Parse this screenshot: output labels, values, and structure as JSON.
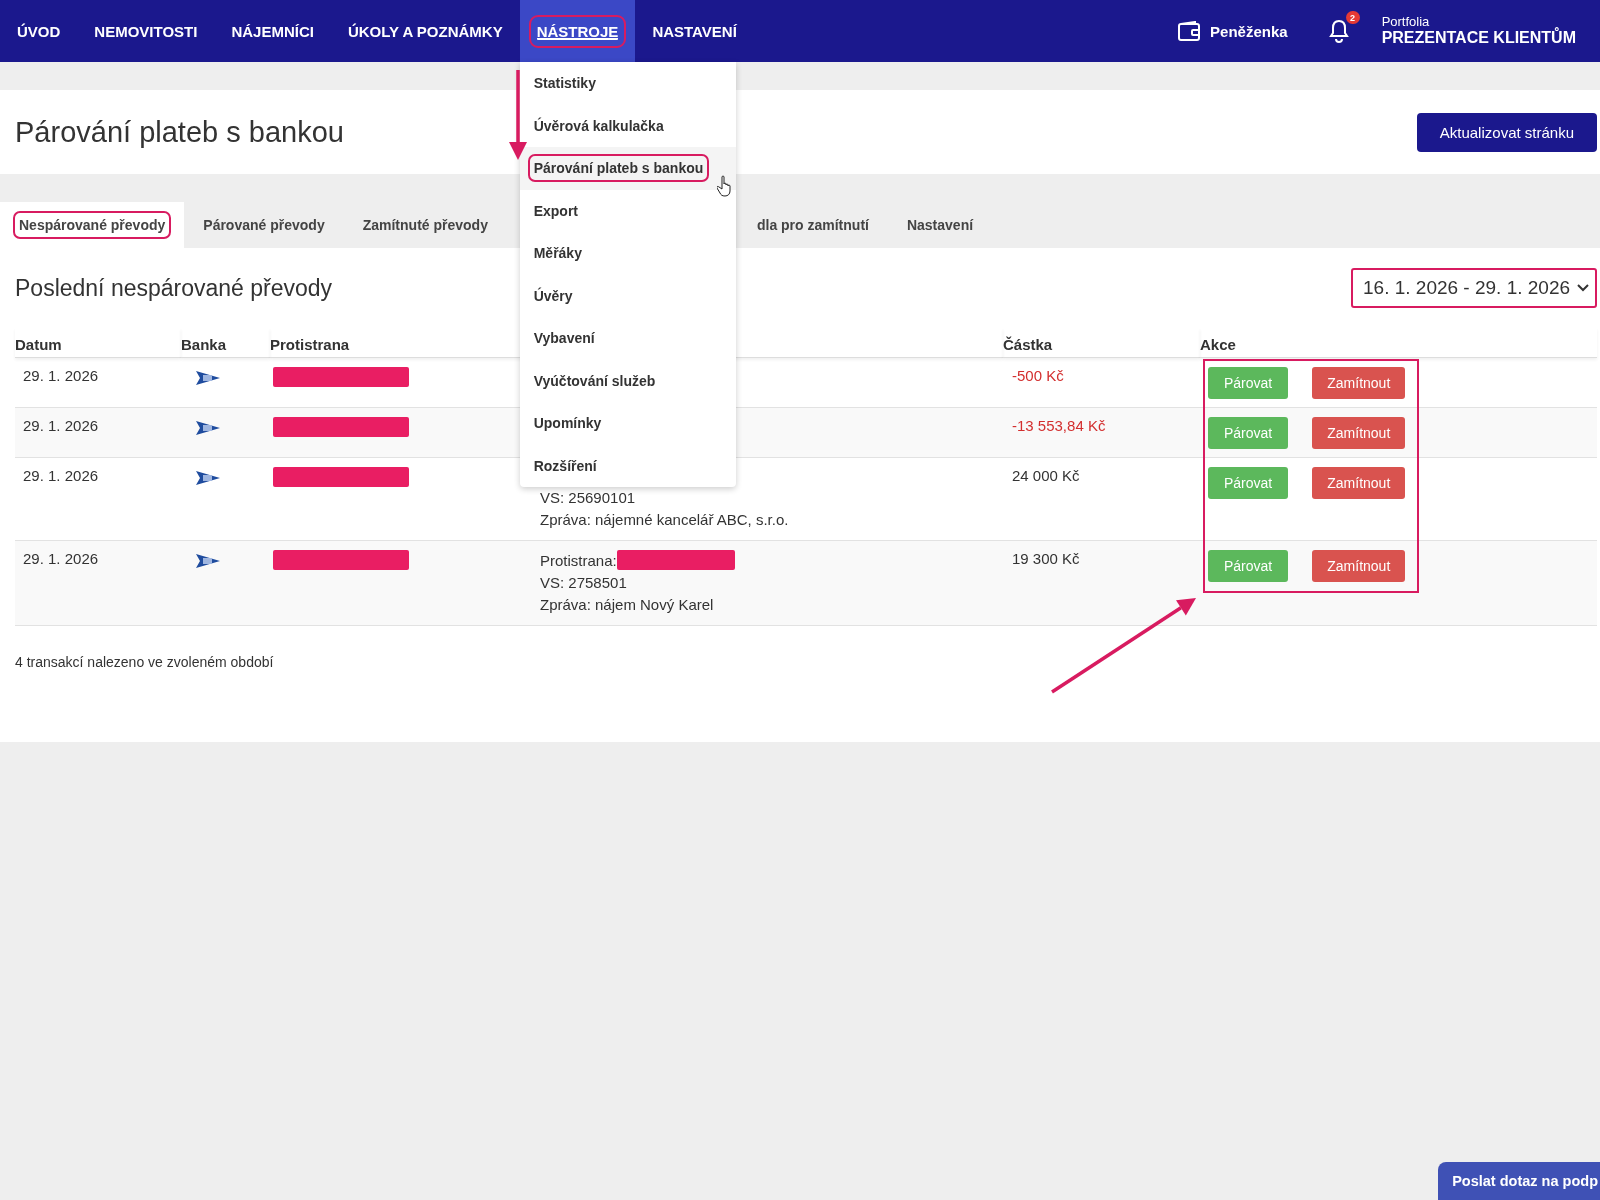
{
  "nav": {
    "items": [
      {
        "label": "ÚVOD",
        "selected": false,
        "highlighted": false
      },
      {
        "label": "NEMOVITOSTI",
        "selected": false,
        "highlighted": false
      },
      {
        "label": "NÁJEMNÍCI",
        "selected": false,
        "highlighted": false
      },
      {
        "label": "ÚKOLY A POZNÁMKY",
        "selected": false,
        "highlighted": false
      },
      {
        "label": "NÁSTROJE",
        "selected": true,
        "highlighted": true
      },
      {
        "label": "NASTAVENÍ",
        "selected": false,
        "highlighted": false
      }
    ],
    "wallet": "Peněženka",
    "notifications": "2",
    "portfolio_label": "Portfolia",
    "portfolio_name": "PREZENTACE KLIENTŮM"
  },
  "dropdown": {
    "items": [
      {
        "label": "Statistiky",
        "hovered": false,
        "highlighted": false
      },
      {
        "label": "Úvěrová kalkulačka",
        "hovered": false,
        "highlighted": false
      },
      {
        "label": "Párování plateb s bankou",
        "hovered": true,
        "highlighted": true
      },
      {
        "label": "Export",
        "hovered": false,
        "highlighted": false
      },
      {
        "label": "Měřáky",
        "hovered": false,
        "highlighted": false
      },
      {
        "label": "Úvěry",
        "hovered": false,
        "highlighted": false
      },
      {
        "label": "Vybavení",
        "hovered": false,
        "highlighted": false
      },
      {
        "label": "Vyúčtování služeb",
        "hovered": false,
        "highlighted": false
      },
      {
        "label": "Upomínky",
        "hovered": false,
        "highlighted": false
      },
      {
        "label": "Rozšíření",
        "hovered": false,
        "highlighted": false
      }
    ]
  },
  "header": {
    "title": "Párování plateb s bankou",
    "button": "Aktualizovat stránku"
  },
  "tabs": [
    {
      "label": "Nespárované převody",
      "selected": true,
      "highlighted": true,
      "kind": "normal"
    },
    {
      "label": "Párované převody",
      "selected": false,
      "highlighted": false,
      "kind": "normal"
    },
    {
      "label": "Zamítnuté převody",
      "selected": false,
      "highlighted": false,
      "kind": "normal"
    },
    {
      "label": "dla pro zamítnutí",
      "selected": false,
      "highlighted": false,
      "kind": "covered"
    },
    {
      "label": "Nastavení",
      "selected": false,
      "highlighted": false,
      "kind": "normal"
    }
  ],
  "section": {
    "title": "Poslední nespárované převody",
    "date_range": "16. 1. 2026 - 29. 1. 2026",
    "date_range_highlighted": true
  },
  "table": {
    "columns": [
      "Datum",
      "Banka",
      "Protistrana",
      "Částka",
      "Akce"
    ],
    "actions_highlighted": true,
    "rows": [
      {
        "date": "29. 1. 2026",
        "counterparty_redacted": true,
        "amount": "-500 Kč",
        "negative": true,
        "actions": [
          {
            "label": "Párovat",
            "kind": "pair"
          },
          {
            "label": "Zamítnout",
            "kind": "reject"
          }
        ]
      },
      {
        "date": "29. 1. 2026",
        "counterparty_redacted": true,
        "amount": "-13 553,84 Kč",
        "negative": true,
        "actions": [
          {
            "label": "Párovat",
            "kind": "pair"
          },
          {
            "label": "Zamítnout",
            "kind": "reject"
          }
        ]
      },
      {
        "date": "29. 1. 2026",
        "counterparty_redacted": true,
        "details": [
          {
            "text": "VS: 25690101",
            "redacted": false
          },
          {
            "text": "Zpráva: nájemné kancelář ABC, s.r.o.",
            "redacted": false
          }
        ],
        "amount": "24 000 Kč",
        "negative": false,
        "actions": [
          {
            "label": "Párovat",
            "kind": "pair"
          },
          {
            "label": "Zamítnout",
            "kind": "reject"
          }
        ]
      },
      {
        "date": "29. 1. 2026",
        "counterparty_redacted": true,
        "details": [
          {
            "text": "Protistrana:",
            "redacted": true
          },
          {
            "text": "VS: 2758501",
            "redacted": false
          },
          {
            "text": "Zpráva: nájem Nový Karel",
            "redacted": false
          }
        ],
        "amount": "19 300 Kč",
        "negative": false,
        "actions": [
          {
            "label": "Párovat",
            "kind": "pair"
          },
          {
            "label": "Zamítnout",
            "kind": "reject"
          }
        ]
      }
    ],
    "footer": "4 transakcí nalezeno ve zvoleném období"
  },
  "annotations": [
    {
      "kind": "arrow"
    },
    {
      "kind": "arrow"
    }
  ],
  "help_button": "Poslat dotaz na podp"
}
